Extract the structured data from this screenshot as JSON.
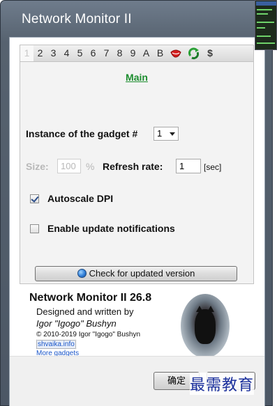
{
  "window": {
    "title": "Network Monitor II"
  },
  "tabs": [
    "1",
    "2",
    "3",
    "4",
    "5",
    "6",
    "7",
    "8",
    "9",
    "A",
    "B"
  ],
  "tab_icons": [
    "lips-icon",
    "recycle-icon",
    "dollar-icon"
  ],
  "tab_dollar": "$",
  "main": {
    "section_title": "Main",
    "instance_label": "Instance of the gadget #",
    "instance_value": "1",
    "size_label": "Size:",
    "size_value": "100",
    "size_unit": "%",
    "refresh_label": "Refresh rate:",
    "refresh_value": "1",
    "refresh_unit": "[sec]",
    "autoscale_label": "Autoscale DPI",
    "autoscale_checked": true,
    "notifications_label": "Enable update notifications",
    "notifications_checked": false,
    "check_button": "Check for updated version"
  },
  "about": {
    "title": "Network Monitor II 26.8",
    "designed": "Designed and written by",
    "author": "Igor \"Igogo\" Bushyn",
    "copyright": "© 2010-2019 Igor \"Igogo\" Bushyn",
    "site_link": "shvaika.info",
    "more_link": "More gadgets"
  },
  "buttons": {
    "ok": "确定"
  },
  "watermark": "最需教育",
  "colors": {
    "accent_green": "#1d8d2f",
    "link_blue": "#1a56c9",
    "title_bar": "#56626f"
  }
}
